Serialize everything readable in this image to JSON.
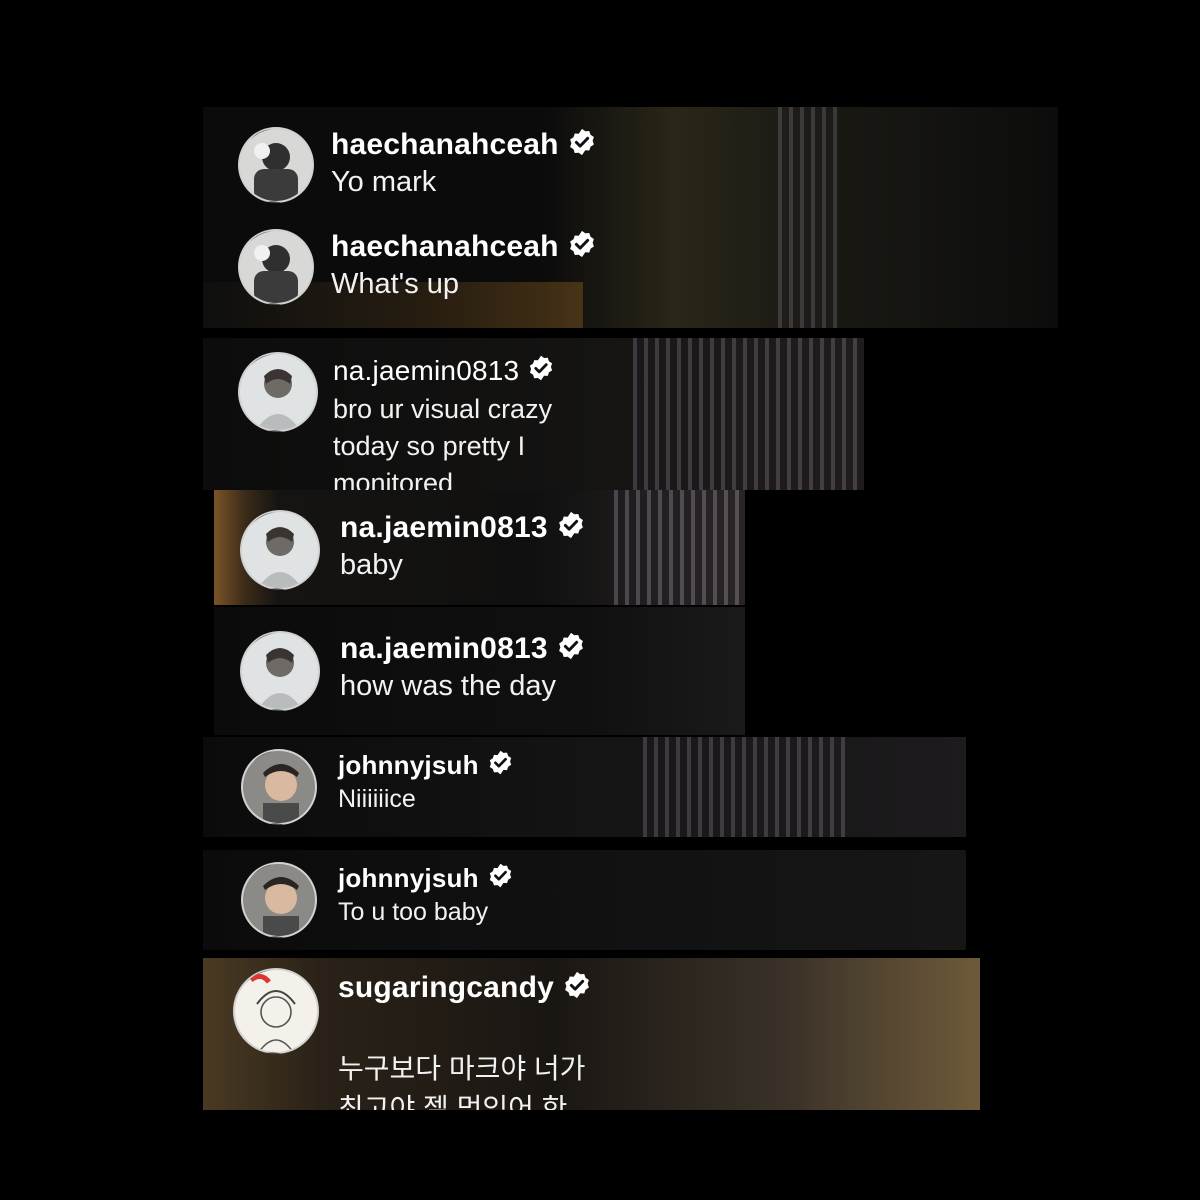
{
  "colors": {
    "page_bg": "#000000",
    "panel_bg": "#0d0c0b",
    "text": "#ffffff",
    "verified_badge": "#ffffff"
  },
  "comments": [
    {
      "username": "haechanahceah",
      "message": "Yo mark",
      "avatar_icon": "profile-photo-icon"
    },
    {
      "username": "haechanahceah",
      "message": "What's up",
      "avatar_icon": "profile-photo-icon"
    },
    {
      "username": "na.jaemin0813",
      "message": "bro ur visual crazy today so pretty I\nmonitored everything",
      "avatar_icon": "profile-photo-icon"
    },
    {
      "username": "na.jaemin0813",
      "message": "baby",
      "avatar_icon": "profile-photo-icon"
    },
    {
      "username": "na.jaemin0813",
      "message": "how was the day",
      "avatar_icon": "profile-photo-icon"
    },
    {
      "username": "johnnyjsuh",
      "message": "Niiiiiice",
      "avatar_icon": "profile-photo-icon"
    },
    {
      "username": "johnnyjsuh",
      "message": "To u too baby",
      "avatar_icon": "profile-photo-icon"
    },
    {
      "username": "sugaringcandy",
      "message": "누구보다 마크야 너가 최고야 젤 멋있어 한국\n돌아와서 보자",
      "avatar_icon": "drawn-portrait-icon",
      "emoji": "thumbs-up-icon"
    }
  ]
}
